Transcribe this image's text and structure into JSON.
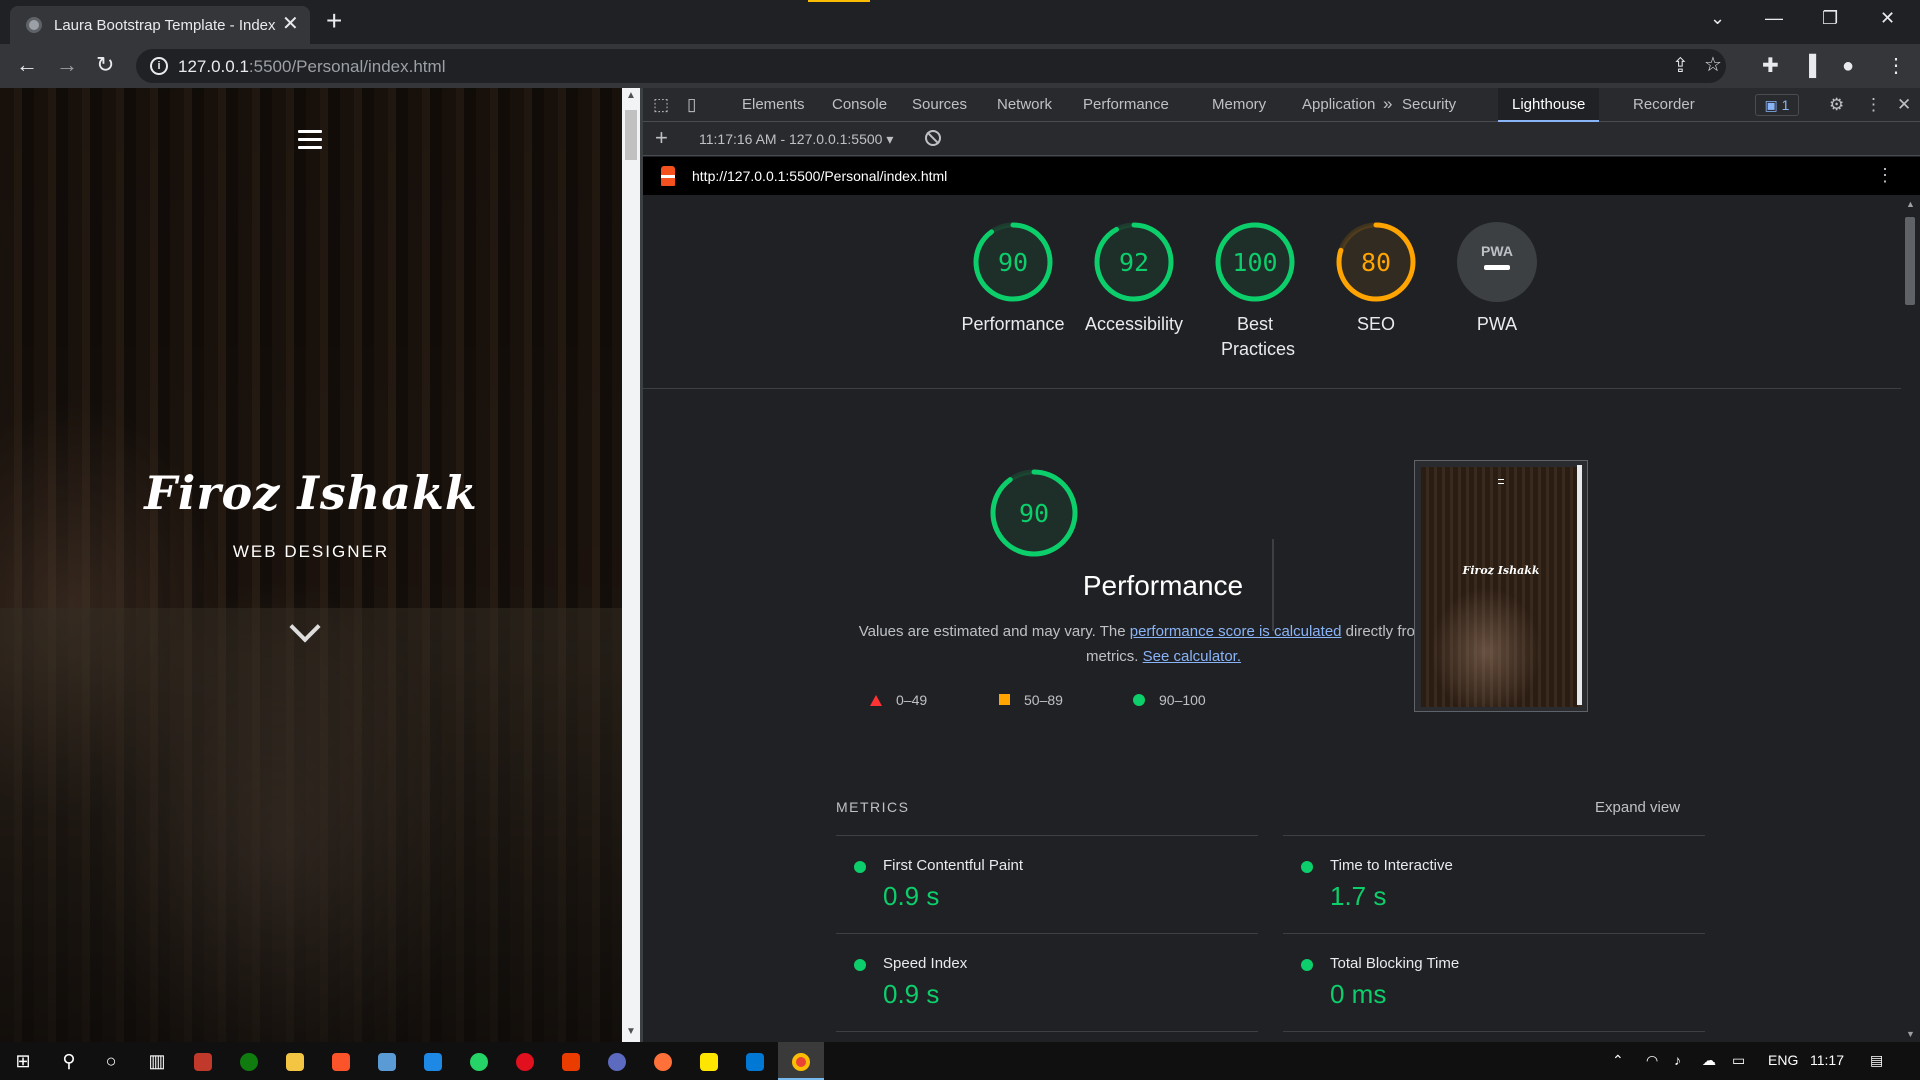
{
  "browser": {
    "tab_title": "Laura Bootstrap Template - Index",
    "tab_close": "✕",
    "new_tab": "+",
    "url_host": "127.0.0.1",
    "url_path": ":5500/Personal/index.html"
  },
  "page": {
    "hero_name": "Firoz Ishakk",
    "hero_role": "WEB DESIGNER"
  },
  "devtools": {
    "tabs": [
      "Elements",
      "Console",
      "Sources",
      "Network",
      "Performance",
      "Memory",
      "Application",
      "Security",
      "Lighthouse",
      "Recorder"
    ],
    "active_tab": "Lighthouse",
    "more_tabs": "»",
    "issues_badge": "1",
    "report_selector": "11:17:16 AM - 127.0.0.1:5500 ▾",
    "report_url": "http://127.0.0.1:5500/Personal/index.html"
  },
  "lighthouse": {
    "gauges": [
      {
        "label": "Performance",
        "score": 90,
        "color": "#0cce6b"
      },
      {
        "label": "Accessibility",
        "score": 92,
        "color": "#0cce6b"
      },
      {
        "label": "Best Practices",
        "score": 100,
        "color": "#0cce6b"
      },
      {
        "label": "SEO",
        "score": 80,
        "color": "#ffa400"
      },
      {
        "label": "PWA",
        "score": "PWA",
        "color": "#9aa0a6"
      }
    ],
    "performance": {
      "score": 90,
      "title": "Performance",
      "desc_pre": "Values are estimated and may vary. The ",
      "desc_link1": "performance score is calculated",
      "desc_mid": " directly from these metrics. ",
      "desc_link2": "See calculator."
    },
    "legend": {
      "fail": "0–49",
      "average": "50–89",
      "pass": "90–100"
    },
    "screenshot_name": "Firoz Ishakk",
    "metrics_heading": "METRICS",
    "expand_view": "Expand view",
    "metrics": [
      {
        "name": "First Contentful Paint",
        "value": "0.9 s"
      },
      {
        "name": "Time to Interactive",
        "value": "1.7 s"
      },
      {
        "name": "Speed Index",
        "value": "0.9 s"
      },
      {
        "name": "Total Blocking Time",
        "value": "0 ms"
      }
    ]
  },
  "taskbar": {
    "language": "ENG",
    "time": "11:17"
  }
}
